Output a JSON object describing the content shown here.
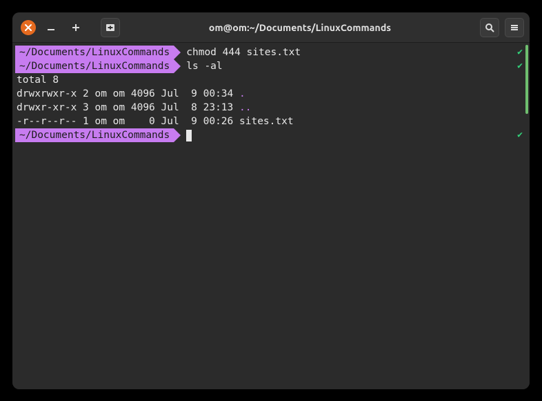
{
  "window": {
    "title": "om@om:~/Documents/LinuxCommands"
  },
  "prompt": "~/Documents/LinuxCommands",
  "lines": {
    "cmd1": "chmod 444 sites.txt",
    "cmd2": "ls -al",
    "total": "total 8",
    "l1a": "drwxrwxr-x 2 om om 4096 Jul  9 00:34 ",
    "l1b": ".",
    "l2a": "drwxr-xr-x 3 om om 4096 Jul  8 23:13 ",
    "l2b": "..",
    "l3": "-r--r--r-- 1 om om    0 Jul  9 00:26 sites.txt"
  },
  "check": "✔"
}
